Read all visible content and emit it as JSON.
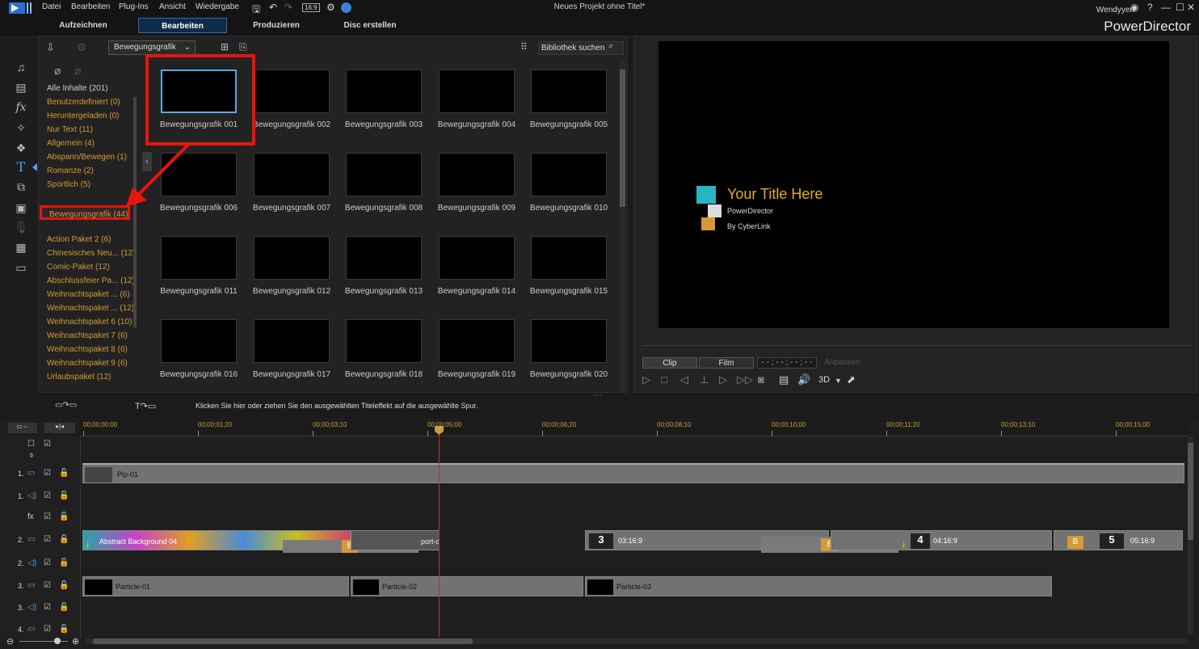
{
  "menu": [
    "Datei",
    "Bearbeiten",
    "Plug-Ins",
    "Ansicht",
    "Wiedergabe"
  ],
  "aspect_ratio": "16:9",
  "window_title": "Neues Projekt ohne Titel*",
  "user": "Wendyyen",
  "tabs": [
    "Aufzeichnen",
    "Bearbeiten",
    "Produzieren",
    "Disc erstellen"
  ],
  "active_tab": "Bearbeiten",
  "brand": "PowerDirector",
  "library": {
    "dropdown": "Bewegungsgrafik",
    "search_placeholder": "Bibliothek suchen",
    "categories": [
      "Alle Inhalte (201)",
      "Benutzerdefiniert  (0)",
      "Heruntergeladen  (0)",
      "Nur Text  (11)",
      "Allgemein  (4)",
      "Abspann/Bewegen  (1)",
      "Romanze  (2)",
      "Sportlich  (5)",
      "Bewegungsgrafik  (44)",
      "Action Paket 2  (6)",
      "Chinesisches Neu...  (12)",
      "Comic-Paket  (12)",
      "Abschlussfeier Pa...  (12)",
      "Weihnachtspaket ...  (6)",
      "Weihnachtspaket ...  (12)",
      "Weihnachtspaket 6  (10)",
      "Weihnachtspaket 7  (6)",
      "Weihnachtspaket 8  (6)",
      "Weihnachtspaket 9  (6)",
      "Urlaubspaket  (12)"
    ],
    "selected_category": "Bewegungsgrafik  (44)",
    "items": [
      "Bewegungsgrafik 001",
      "Bewegungsgrafik 002",
      "Bewegungsgrafik 003",
      "Bewegungsgrafik 004",
      "Bewegungsgrafik 005",
      "Bewegungsgrafik 006",
      "Bewegungsgrafik 007",
      "Bewegungsgrafik 008",
      "Bewegungsgrafik 009",
      "Bewegungsgrafik 010",
      "Bewegungsgrafik 011",
      "Bewegungsgrafik 012",
      "Bewegungsgrafik 013",
      "Bewegungsgrafik 014",
      "Bewegungsgrafik 015",
      "Bewegungsgrafik 016",
      "Bewegungsgrafik 017",
      "Bewegungsgrafik 018",
      "Bewegungsgrafik 019",
      "Bewegungsgrafik 020"
    ],
    "selected_item": "Bewegungsgrafik 001"
  },
  "preview": {
    "title": "Your Title Here",
    "subtitle1": "PowerDirector",
    "subtitle2": "By CyberLink",
    "clip_label": "Clip",
    "film_label": "Film",
    "timecode": "- - ; - - ; - - ; - -",
    "fit_label": "Anpassen",
    "mode_3d": "3D"
  },
  "hint": "Klicken Sie hier oder ziehen Sie den ausgewählten Titeleffekt auf die ausgewählte Spur.",
  "ruler": [
    "00;00;00;00",
    "00;00;01;20",
    "00;00;03;10",
    "00;00;05;00",
    "00;00;06;20",
    "00;00;08;10",
    "00;00;10;00",
    "00;00;11;20",
    "00;00;13;10",
    "00;00;15;00"
  ],
  "tracks": {
    "pip": "Pip-01",
    "video2a": "Abstract Background 04",
    "video2b": "port-c",
    "t3": "3",
    "t3tc": "03:16:9",
    "t4": "4",
    "t4tc": "04:16:9",
    "t5": "5",
    "t5tc": "05:16:9",
    "particle1": "Particle-01",
    "particle2": "Particle-02",
    "particle3": "Particle-03"
  },
  "track_numbers": [
    "1.",
    "1.",
    "2.",
    "2.",
    "3.",
    "3.",
    "4."
  ],
  "colors": {
    "accent": "#d49a35",
    "highlight": "#e8140f",
    "selection": "#5aa7e4"
  }
}
